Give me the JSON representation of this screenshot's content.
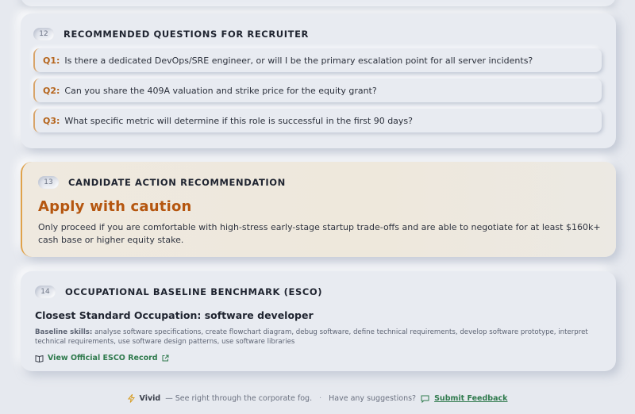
{
  "questions_card": {
    "number": "12",
    "title": "RECOMMENDED QUESTIONS FOR RECRUITER",
    "items": [
      {
        "label": "Q1:",
        "text": "Is there a dedicated DevOps/SRE engineer, or will I be the primary escalation point for all server incidents?"
      },
      {
        "label": "Q2:",
        "text": "Can you share the 409A valuation and strike price for the equity grant?"
      },
      {
        "label": "Q3:",
        "text": "What specific metric will determine if this role is successful in the first 90 days?"
      }
    ]
  },
  "action_card": {
    "number": "13",
    "title": "CANDIDATE ACTION RECOMMENDATION",
    "verdict": "Apply with caution",
    "text": "Only proceed if you are comfortable with high-stress early-stage startup trade-offs and are able to negotiate for at least $160k+ cash base or higher equity stake.",
    "accent_color": "#e0a24a"
  },
  "esco_card": {
    "number": "14",
    "title": "OCCUPATIONAL BASELINE BENCHMARK (ESCO)",
    "occupation": "Closest Standard Occupation: software developer",
    "skills_label": "Baseline skills:",
    "skills_text": " analyse software specifications, create flowchart diagram, debug software, define technical requirements, develop software prototype, interpret technical requirements, use software design patterns, use software libraries",
    "link_label": "View Official ESCO Record",
    "link_icon": "book-icon",
    "external_icon": "external-link-icon"
  },
  "footer": {
    "brand": "Vivid",
    "tagline": "— See right through the corporate fog.",
    "separator": "·",
    "prompt": "Have any suggestions?",
    "feedback_label": "Submit Feedback",
    "brand_icon": "lightning-icon",
    "feedback_icon": "chat-icon"
  },
  "colors": {
    "background": "#e6e9ef",
    "question_label": "#b5651d",
    "verdict": "#b5560f",
    "link": "#2f7a4d"
  }
}
